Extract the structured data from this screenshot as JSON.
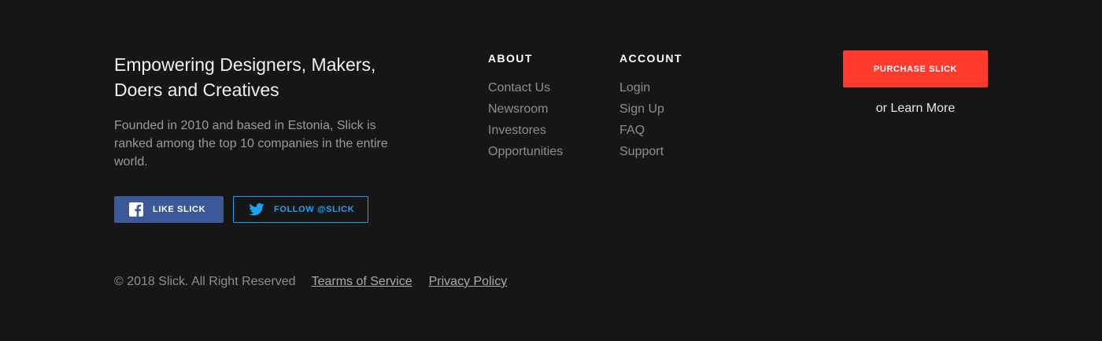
{
  "brand": {
    "title": "Empowering Designers, Makers, Doers and Creatives",
    "description": "Founded in 2010 and based in Estonia, Slick is ranked among the top 10 companies in the entire world."
  },
  "social": {
    "facebook_label": "LIKE SLICK",
    "twitter_label": "FOLLOW @SLICK",
    "facebook_color": "#3b5998",
    "twitter_color": "#1da1f2"
  },
  "about": {
    "heading": "ABOUT",
    "links": [
      "Contact Us",
      "Newsroom",
      "Investores",
      "Opportunities"
    ]
  },
  "account": {
    "heading": "ACCOUNT",
    "links": [
      "Login",
      "Sign Up",
      "FAQ",
      "Support"
    ]
  },
  "cta": {
    "purchase_label": "PURCHASE SLICK",
    "learn_more_prefix": "or",
    "learn_more_label": "Learn More",
    "accent_color": "#ff3b2f"
  },
  "bottom": {
    "copyright": "© 2018 Slick. All Right Reserved",
    "terms_label": "Tearms of Service",
    "privacy_label": "Privacy Policy"
  },
  "theme": {
    "background": "#171617"
  }
}
